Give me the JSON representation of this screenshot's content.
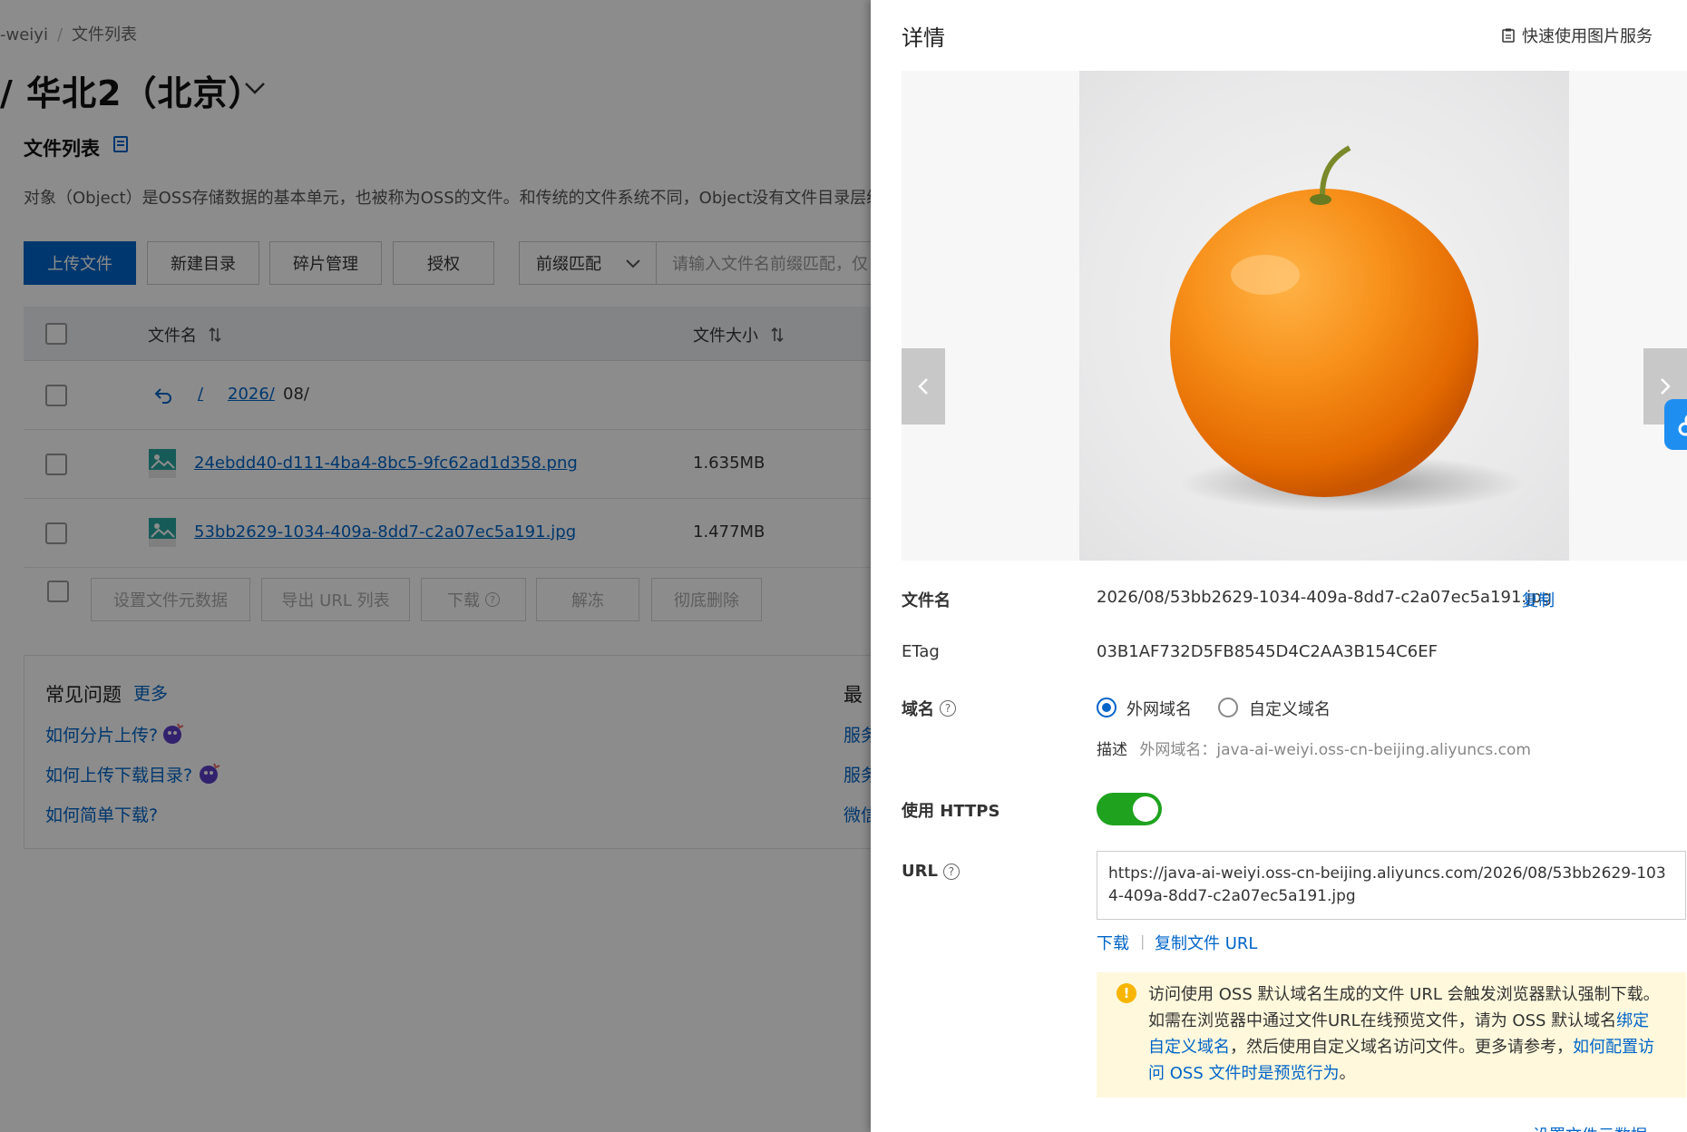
{
  "breadcrumb": {
    "bucket": "-weiyi",
    "separator": "/",
    "current": "文件列表"
  },
  "region": {
    "title": "/ 华北2（北京）"
  },
  "section": {
    "title": "文件列表",
    "description": "对象（Object）是OSS存储数据的基本单元，也被称为OSS的文件。和传统的文件系统不同，Object没有文件目录层级结构"
  },
  "toolbar": {
    "upload": "上传文件",
    "new_dir": "新建目录",
    "fragments": "碎片管理",
    "authorize": "授权",
    "match_select": "前缀匹配",
    "search_placeholder": "请输入文件名前缀匹配，仅"
  },
  "table": {
    "col_name": "文件名",
    "col_size": "文件大小",
    "path": {
      "root": "/",
      "year": "2026/",
      "month": "08/"
    },
    "rows": [
      {
        "name": "24ebdd40-d111-4ba4-8bc5-9fc62ad1d358.png",
        "size": "1.635MB"
      },
      {
        "name": "53bb2629-1034-409a-8dd7-c2a07ec5a191.jpg",
        "size": "1.477MB"
      }
    ]
  },
  "bulk_actions": {
    "set_meta": "设置文件元数据",
    "export_urls": "导出 URL 列表",
    "download": "下载",
    "unfreeze": "解冻",
    "delete": "彻底删除"
  },
  "faq": {
    "title": "常见问题",
    "more": "更多",
    "items": [
      "如何分片上传?",
      "如何上传下载目录?",
      "如何简单下载?"
    ],
    "best_title": "最",
    "best_items": [
      "服务",
      "服务",
      "微信"
    ]
  },
  "drawer": {
    "title": "详情",
    "quick_service": "快速使用图片服务",
    "fields": {
      "filename_label": "文件名",
      "filename_value": "2026/08/53bb2629-1034-409a-8dd7-c2a07ec5a191.jpg",
      "copy": "复制",
      "etag_label": "ETag",
      "etag_value": "03B1AF732D5FB8545D4C2AA3B154C6EF",
      "domain_label": "域名",
      "domain_public": "外网域名",
      "domain_custom": "自定义域名",
      "domain_desc_label": "描述",
      "domain_desc_value": "外网域名：java-ai-weiyi.oss-cn-beijing.aliyuncs.com",
      "https_label": "使用 HTTPS",
      "https_enabled": true,
      "url_label": "URL",
      "url_value": "https://java-ai-weiyi.oss-cn-beijing.aliyuncs.com/2026/08/53bb2629-1034-409a-8dd7-c2a07ec5a191.jpg",
      "download": "下载",
      "copy_url": "复制文件 URL"
    },
    "notice": {
      "line1": "访问使用 OSS 默认域名生成的文件 URL 会触发浏览器默认强制下载。",
      "line2_a": "如需在浏览器中通过文件URL在线预览文件，请为 OSS 默认域名",
      "line2_link": "绑定自定义域名",
      "line2_b": "，然后使用自定义域名访问文件。更多请参考，",
      "line2_link2": "如何配置访问 OSS 文件时是预览行为",
      "line2_end": "。"
    },
    "bottom_link": "设置文件元数据"
  },
  "colors": {
    "primary": "#0064c8",
    "toggle_on": "#1fa31f",
    "notice_bg": "#fff8dc",
    "warn": "#f7b500"
  }
}
